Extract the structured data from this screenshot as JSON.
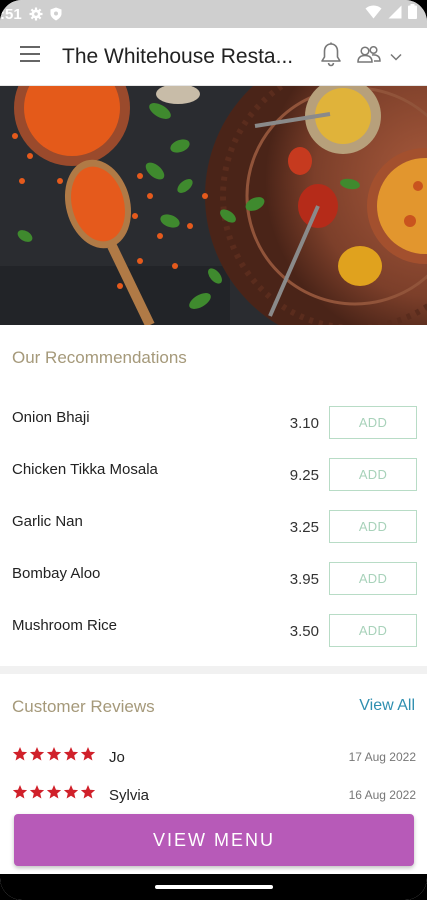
{
  "status_bar": {
    "time": ":51"
  },
  "app_bar": {
    "title": "The Whitehouse Resta..."
  },
  "recommendations": {
    "title": "Our Recommendations",
    "add_label": "ADD",
    "items": [
      {
        "name": "Onion Bhaji",
        "price": "3.10"
      },
      {
        "name": "Chicken Tikka Mosala",
        "price": "9.25"
      },
      {
        "name": "Garlic Nan",
        "price": "3.25"
      },
      {
        "name": "Bombay Aloo",
        "price": "3.95"
      },
      {
        "name": "Mushroom Rice",
        "price": "3.50"
      }
    ]
  },
  "reviews": {
    "title": "Customer Reviews",
    "view_all": "View All",
    "items": [
      {
        "name": "Jo",
        "date": "17 Aug 2022",
        "rating": 5
      },
      {
        "name": "Sylvia",
        "date": "16 Aug 2022",
        "rating": 5
      }
    ]
  },
  "cta": {
    "label": "VIEW MENU"
  },
  "colors": {
    "accent": "#b75ab8",
    "section_title": "#a5997a",
    "link": "#2f8fb0",
    "star": "#d0202a",
    "add_border": "#b8dcc6"
  }
}
